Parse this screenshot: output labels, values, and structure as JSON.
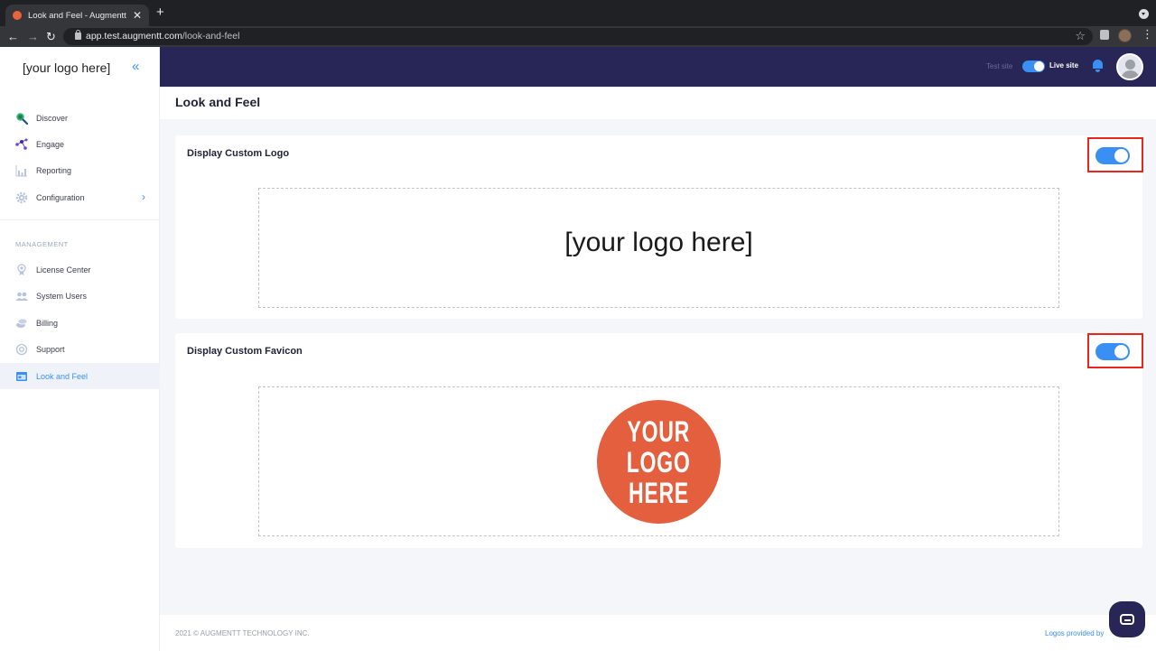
{
  "browser": {
    "tab_title": "Look and Feel - Augmentt",
    "tab_close": "✕",
    "new_tab": "+",
    "url_host": "app.test.augmentt.com",
    "url_path": "/look-and-feel",
    "back": "←",
    "forward": "→",
    "reload": "↻",
    "star": "☆",
    "menu": "⋮"
  },
  "sidebar": {
    "logo_text": "[your logo here]",
    "collapse_glyph": "«",
    "items": [
      {
        "label": "Discover",
        "icon": "search-icon"
      },
      {
        "label": "Engage",
        "icon": "network-icon"
      },
      {
        "label": "Reporting",
        "icon": "chart-icon"
      },
      {
        "label": "Configuration",
        "icon": "gear-icon",
        "chevron": "›"
      }
    ],
    "section_title": "MANAGEMENT",
    "management_items": [
      {
        "label": "License Center",
        "icon": "license-icon"
      },
      {
        "label": "System Users",
        "icon": "users-icon"
      },
      {
        "label": "Billing",
        "icon": "billing-icon"
      },
      {
        "label": "Support",
        "icon": "support-icon"
      },
      {
        "label": "Look and Feel",
        "icon": "palette-icon",
        "active": true
      }
    ]
  },
  "header": {
    "test_site": "Test site",
    "live_site": "Live site",
    "live_enabled": true
  },
  "page": {
    "title": "Look and Feel"
  },
  "cards": {
    "logo": {
      "title": "Display Custom Logo",
      "enabled": true,
      "preview_text": "[your logo here]"
    },
    "favicon": {
      "title": "Display Custom Favicon",
      "enabled": true,
      "preview_lines": [
        "YOUR",
        "LOGO",
        "HERE"
      ]
    }
  },
  "footer": {
    "copyright": "2021 © AUGMENTT TECHNOLOGY INC.",
    "logos_provided": "Logos provided by"
  },
  "colors": {
    "accent": "#3a8ff5",
    "header_bg": "#272656",
    "favicon_bg": "#e45f3e",
    "highlight": "#e8261e"
  }
}
